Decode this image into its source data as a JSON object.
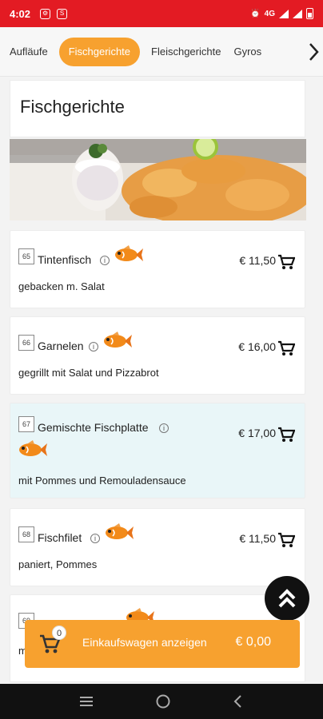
{
  "status": {
    "time": "4:02",
    "network": "4G"
  },
  "tabs": [
    "Aufläufe",
    "Fischgerichte",
    "Fleischgerichte",
    "Gyros"
  ],
  "active_tab": "Fischgerichte",
  "section_title": "Fischgerichte",
  "items": [
    {
      "number": "65",
      "name": "Tintenfisch",
      "price": "€ 11,50",
      "description": "gebacken m. Salat"
    },
    {
      "number": "66",
      "name": "Garnelen",
      "price": "€ 16,00",
      "description": "gegrillt mit Salat und Pizzabrot"
    },
    {
      "number": "67",
      "name": "Gemischte Fischplatte",
      "price": "€ 17,00",
      "description": "mit Pommes und Remouladensauce"
    },
    {
      "number": "68",
      "name": "Fischfilet",
      "price": "€ 11,50",
      "description": "paniert, Pommes"
    },
    {
      "number": "69",
      "name": "",
      "price": "",
      "description": "m"
    }
  ],
  "cart": {
    "count": "0",
    "label": "Einkaufswagen anzeigen",
    "total": "€ 0,00"
  },
  "icons": {
    "cart": "shopping-cart-icon",
    "info": "info-icon",
    "fish": "fish-icon",
    "scroll_top": "double-chevron-up-icon"
  },
  "colors": {
    "status_bar": "#e31b23",
    "accent": "#f7a12f",
    "highlight_row": "#e9f6f8"
  }
}
